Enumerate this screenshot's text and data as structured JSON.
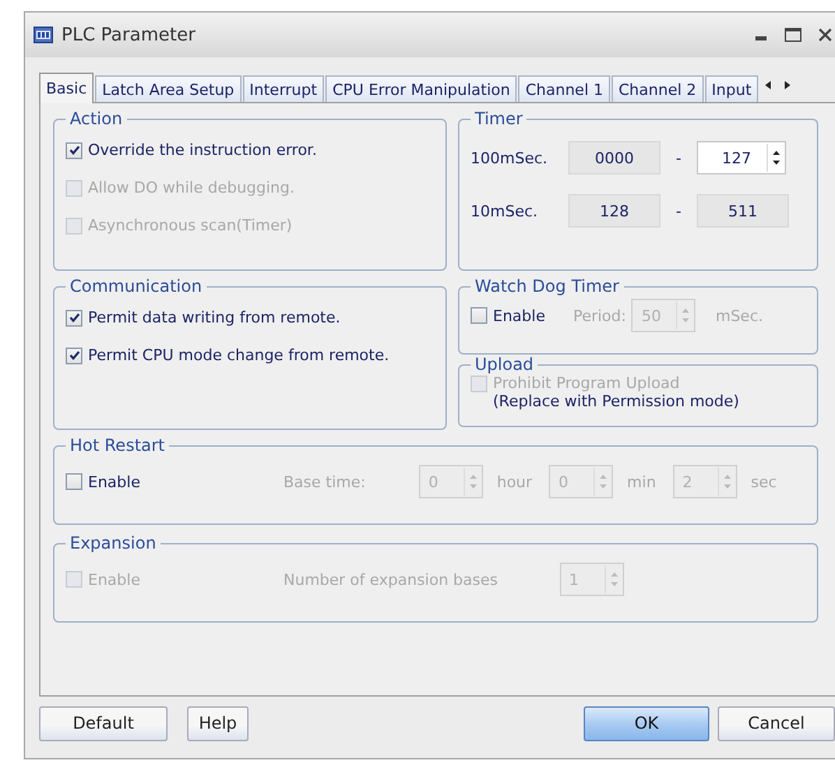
{
  "window": {
    "title": "PLC Parameter"
  },
  "tabs": [
    {
      "label": "Basic",
      "selected": true
    },
    {
      "label": "Latch Area Setup",
      "selected": false
    },
    {
      "label": "Interrupt",
      "selected": false
    },
    {
      "label": "CPU Error Manipulation",
      "selected": false
    },
    {
      "label": "Channel 1",
      "selected": false
    },
    {
      "label": "Channel 2",
      "selected": false
    },
    {
      "label": "Input",
      "selected": false
    }
  ],
  "action": {
    "title": "Action",
    "items": [
      {
        "label": "Override the instruction error.",
        "checked": true,
        "disabled": false
      },
      {
        "label": "Allow DO while debugging.",
        "checked": false,
        "disabled": true
      },
      {
        "label": "Asynchronous scan(Timer)",
        "checked": false,
        "disabled": true
      }
    ]
  },
  "timer": {
    "title": "Timer",
    "rows": [
      {
        "label": "100mSec.",
        "start": "0000",
        "separator": "-",
        "end": "127",
        "kind": "spin"
      },
      {
        "label": "10mSec.",
        "start": "128",
        "separator": "-",
        "end": "511",
        "kind": "static"
      }
    ]
  },
  "communication": {
    "title": "Communication",
    "items": [
      {
        "label": "Permit data writing from remote.",
        "checked": true,
        "disabled": false
      },
      {
        "label": "Permit CPU mode change from remote.",
        "checked": true,
        "disabled": false
      }
    ]
  },
  "watch_dog": {
    "title": "Watch Dog Timer",
    "enable": {
      "label": "Enable",
      "checked": false,
      "disabled": false
    },
    "period_label": "Period:",
    "period": "50",
    "unit": "mSec.",
    "disabled": true
  },
  "upload": {
    "title": "Upload",
    "option": {
      "label": "Prohibit Program Upload",
      "checked": false,
      "disabled": true
    },
    "note": "(Replace with Permission mode)"
  },
  "hot_restart": {
    "title": "Hot Restart",
    "enable": {
      "label": "Enable",
      "checked": false,
      "disabled": false
    },
    "base_time_label": "Base time:",
    "disabled": true,
    "fields": [
      {
        "value": "0",
        "unit": "hour"
      },
      {
        "value": "0",
        "unit": "min"
      },
      {
        "value": "2",
        "unit": "sec"
      }
    ]
  },
  "expansion": {
    "title": "Expansion",
    "enable": {
      "label": "Enable",
      "checked": false,
      "disabled": true
    },
    "bases_label": "Number of expansion bases",
    "bases": "1",
    "disabled": true
  },
  "buttons": [
    {
      "label": "Default",
      "kind": "normal"
    },
    {
      "label": "Help",
      "kind": "normal"
    },
    {
      "label": "OK",
      "kind": "primary"
    },
    {
      "label": "Cancel",
      "kind": "normal"
    }
  ]
}
